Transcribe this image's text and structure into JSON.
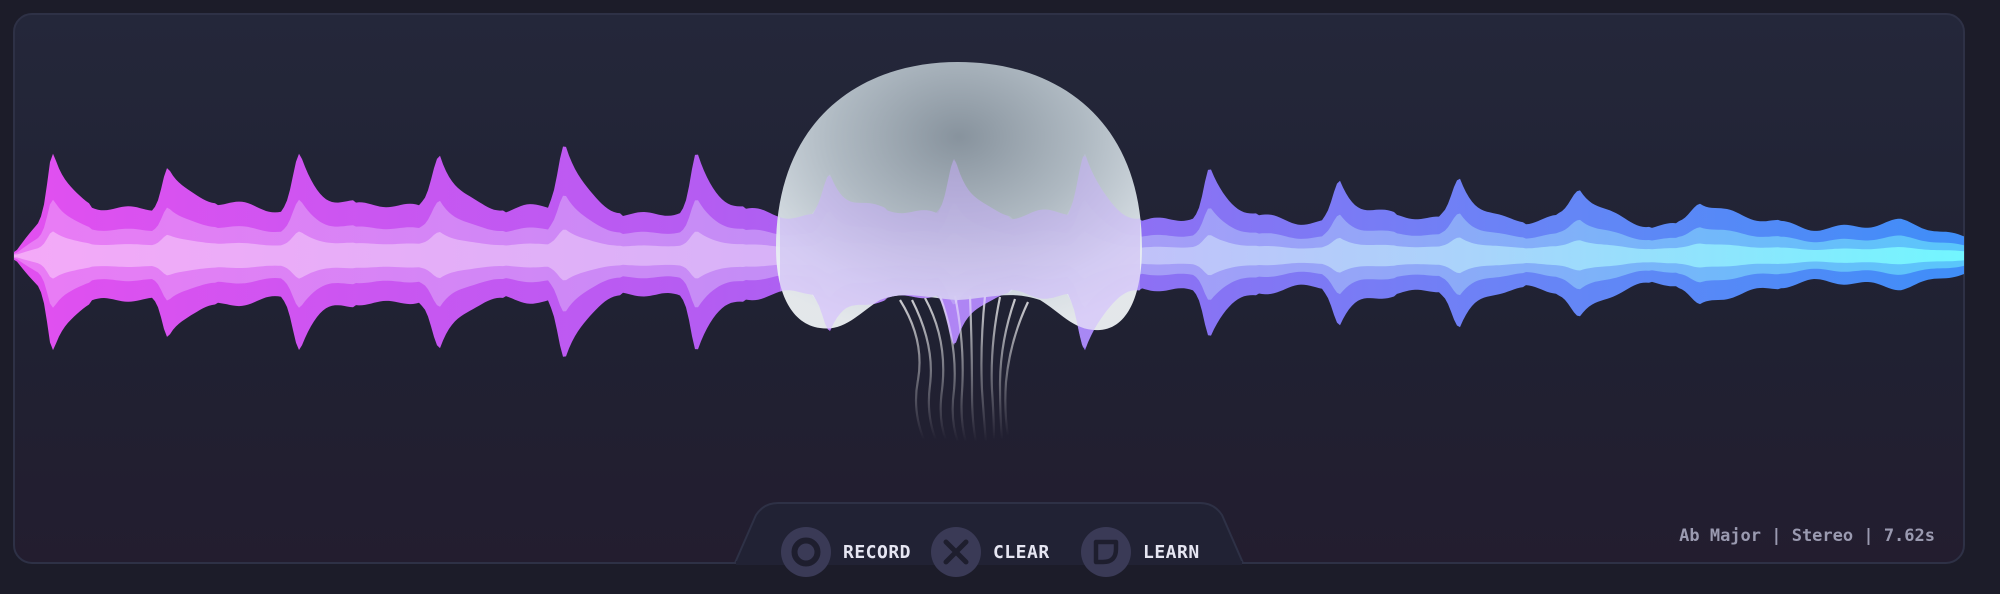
{
  "visualizer": {
    "colors": {
      "background": "#1c1c29",
      "panel": "#222436",
      "wave_start": "#e040f0",
      "wave_mid": "#a070f5",
      "wave_end": "#4090f8",
      "wave_core_end": "#70f8ff"
    }
  },
  "controls": {
    "record": {
      "label": "RECORD",
      "icon": "ring-icon"
    },
    "clear": {
      "label": "CLEAR",
      "icon": "x-icon"
    },
    "learn": {
      "label": "LEARN",
      "icon": "leaf-tag-icon"
    }
  },
  "status": {
    "text": "Ab Major | Stereo | 7.62s"
  }
}
